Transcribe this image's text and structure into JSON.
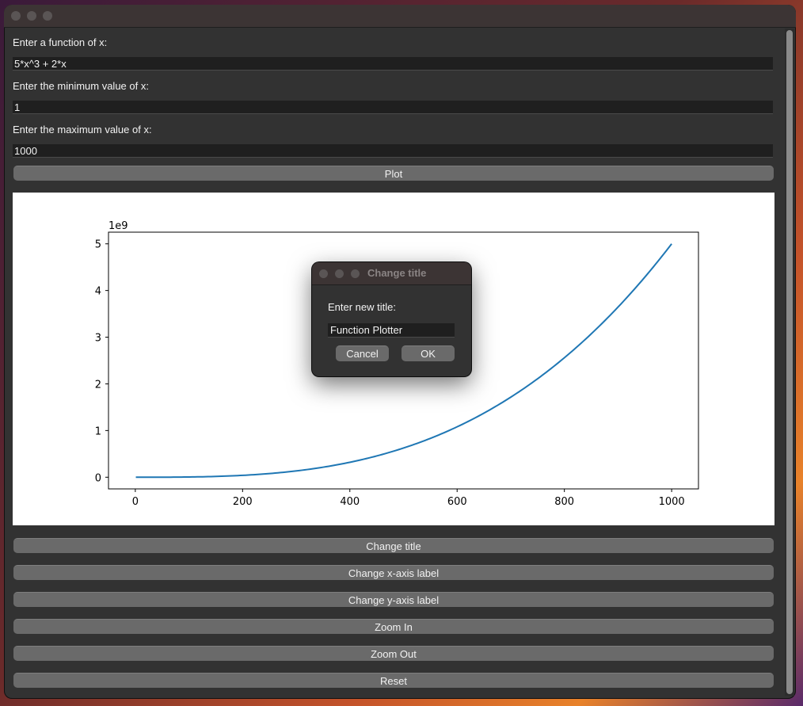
{
  "form": {
    "function_label": "Enter a function of x:",
    "function_value": "5*x^3 + 2*x",
    "min_label": "Enter the minimum value of x:",
    "min_value": "1",
    "max_label": "Enter the maximum value of x:",
    "max_value": "1000",
    "plot_button": "Plot"
  },
  "chart_data": {
    "type": "line",
    "title": "",
    "xlabel": "",
    "ylabel": "",
    "function": "5*x^3 + 2*x",
    "x_range": [
      1,
      1000
    ],
    "xlim": [
      -50,
      1050
    ],
    "ylim": [
      -0.25,
      5.25
    ],
    "y_multiplier_label": "1e9",
    "x_ticks": [
      0,
      200,
      400,
      600,
      800,
      1000
    ],
    "x_tick_labels": [
      "0",
      "200",
      "400",
      "600",
      "800",
      "1000"
    ],
    "y_ticks": [
      0,
      1,
      2,
      3,
      4,
      5
    ],
    "y_tick_labels": [
      "0",
      "1",
      "2",
      "3",
      "4",
      "5"
    ],
    "series": [
      {
        "color": "#1f77b4"
      }
    ],
    "grid": false
  },
  "controls": {
    "change_title": "Change title",
    "change_xlabel": "Change x-axis label",
    "change_ylabel": "Change y-axis label",
    "zoom_in": "Zoom In",
    "zoom_out": "Zoom Out",
    "reset": "Reset"
  },
  "dialog": {
    "title": "Change title",
    "prompt": "Enter new title:",
    "input_value": "Function Plotter",
    "cancel": "Cancel",
    "ok": "OK"
  }
}
